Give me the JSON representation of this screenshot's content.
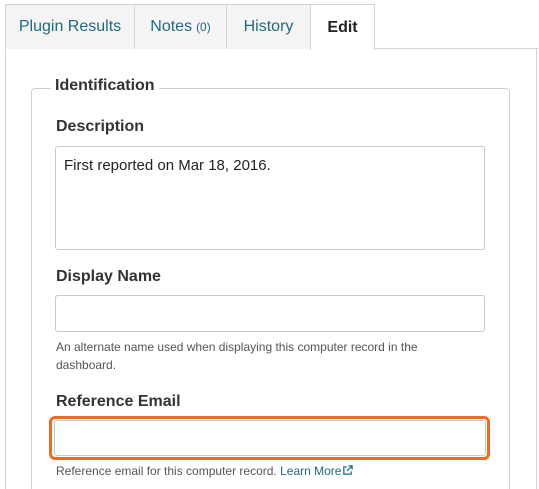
{
  "tabs": {
    "plugin_results": "Plugin Results",
    "notes": "Notes",
    "notes_count": "(0)",
    "history": "History",
    "edit": "Edit"
  },
  "identification": {
    "legend": "Identification",
    "description_label": "Description",
    "description_value": "First reported on Mar 18, 2016.",
    "display_name_label": "Display Name",
    "display_name_value": "",
    "display_name_help": "An alternate name used when displaying this computer record in the dashboard.",
    "reference_email_label": "Reference Email",
    "reference_email_value": "",
    "reference_email_help": "Reference email for this computer record.",
    "learn_more": "Learn More"
  },
  "colors": {
    "link": "#1d6a80",
    "highlight": "#f26b1d"
  },
  "icons": {
    "external_link": "external-link-icon"
  }
}
